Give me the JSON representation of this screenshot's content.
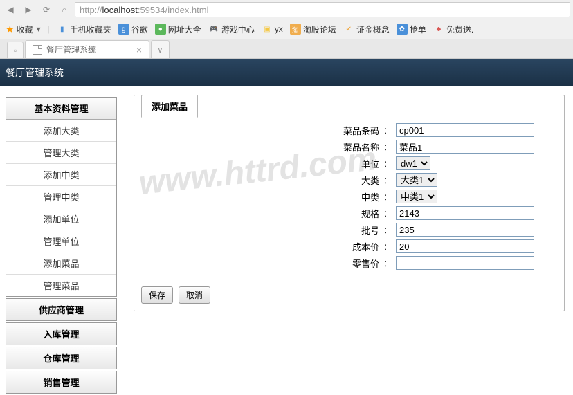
{
  "browser": {
    "url_prefix": "http://",
    "url_host": "localhost",
    "url_port": ":59534",
    "url_path": "/index.html",
    "favorites_label": "收藏",
    "bookmarks": [
      "手机收藏夹",
      "谷歌",
      "网址大全",
      "游戏中心",
      "yx",
      "淘股论坛",
      "证金概念",
      "抢单",
      "免费送."
    ],
    "tab_title": "餐厅管理系统"
  },
  "app": {
    "header_title": "餐厅管理系统"
  },
  "sidebar": {
    "groups": [
      {
        "title": "基本资料管理",
        "expanded": true,
        "items": [
          "添加大类",
          "管理大类",
          "添加中类",
          "管理中类",
          "添加单位",
          "管理单位",
          "添加菜品",
          "管理菜品"
        ]
      },
      {
        "title": "供应商管理",
        "expanded": false,
        "items": []
      },
      {
        "title": "入库管理",
        "expanded": false,
        "items": []
      },
      {
        "title": "仓库管理",
        "expanded": false,
        "items": []
      },
      {
        "title": "销售管理",
        "expanded": false,
        "items": []
      }
    ]
  },
  "content": {
    "tab_title": "添加菜品",
    "fields": {
      "barcode": {
        "label": "菜品条码",
        "value": "cp001"
      },
      "name": {
        "label": "菜品名称",
        "value": "菜品1"
      },
      "unit": {
        "label": "单位",
        "value": "dw1"
      },
      "bigcat": {
        "label": "大类",
        "value": "大类1"
      },
      "midcat": {
        "label": "中类",
        "value": "中类1"
      },
      "spec": {
        "label": "规格",
        "value": "2143"
      },
      "batch": {
        "label": "批号",
        "value": "235"
      },
      "cost": {
        "label": "成本价",
        "value": "20"
      },
      "retail": {
        "label": "零售价",
        "value": ""
      }
    },
    "buttons": {
      "save": "保存",
      "cancel": "取消"
    }
  },
  "watermark": "www.httrd.com"
}
